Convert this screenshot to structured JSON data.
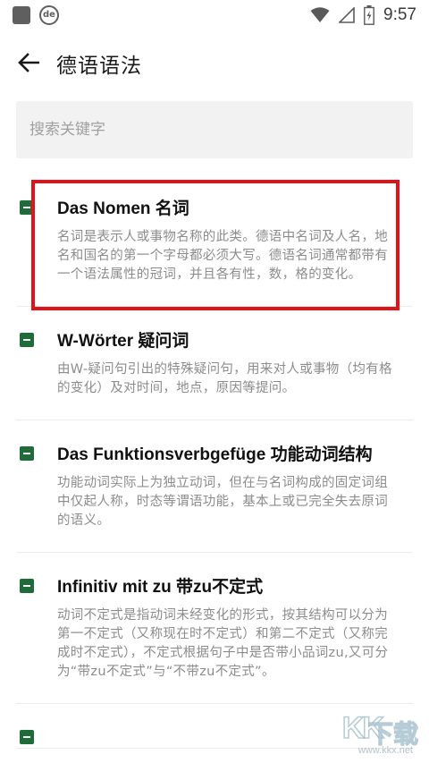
{
  "status_bar": {
    "time": "9:57",
    "app_badge": "de",
    "icons": [
      "notification-square-icon",
      "de-app-icon",
      "wifi-icon",
      "signal-icon",
      "battery-icon"
    ]
  },
  "appbar": {
    "title": "德语语法",
    "back_icon": "arrow-left-icon"
  },
  "search": {
    "placeholder": "搜索关键字",
    "value": ""
  },
  "items": [
    {
      "title": "Das Nomen 名词",
      "desc": "名词是表示人或事物名称的此类。德语中名词及人名，地名和国名的第一个字母都必须大写。德语名词通常都带有一个语法属性的冠词，并且各有性，数，格的变化。"
    },
    {
      "title": "W-Wörter 疑问词",
      "desc": "由W-疑问句引出的特殊疑问句，用来对人或事物（均有格的变化）及对时间，地点，原因等提问。"
    },
    {
      "title": "Das Funktionsverbgefüge 功能动词结构",
      "desc": "功能动词实际上为独立动词，但在与名词构成的固定词组中仅起人称，时态等谓语功能，基本上或已完全失去原词的语义。"
    },
    {
      "title": "Infinitiv mit zu  带zu不定式",
      "desc": "动词不定式是指动词未经变化的形式，按其结构可以分为第一不定式（又称现在时不定式）和第二不定式（又称完成时不定式），不定式根据句子中是否带小品词zu,又可分为“带zu不定式”与“不带zu不定式”。"
    },
    {
      "title": "",
      "desc": ""
    }
  ],
  "watermark": {
    "brand": "KK",
    "brand_cn": "下载",
    "url": "www.kkx.net"
  },
  "colors": {
    "accent": "#1f6b3a",
    "highlight": "#e0121a",
    "search_bg": "#f2f2f2"
  }
}
